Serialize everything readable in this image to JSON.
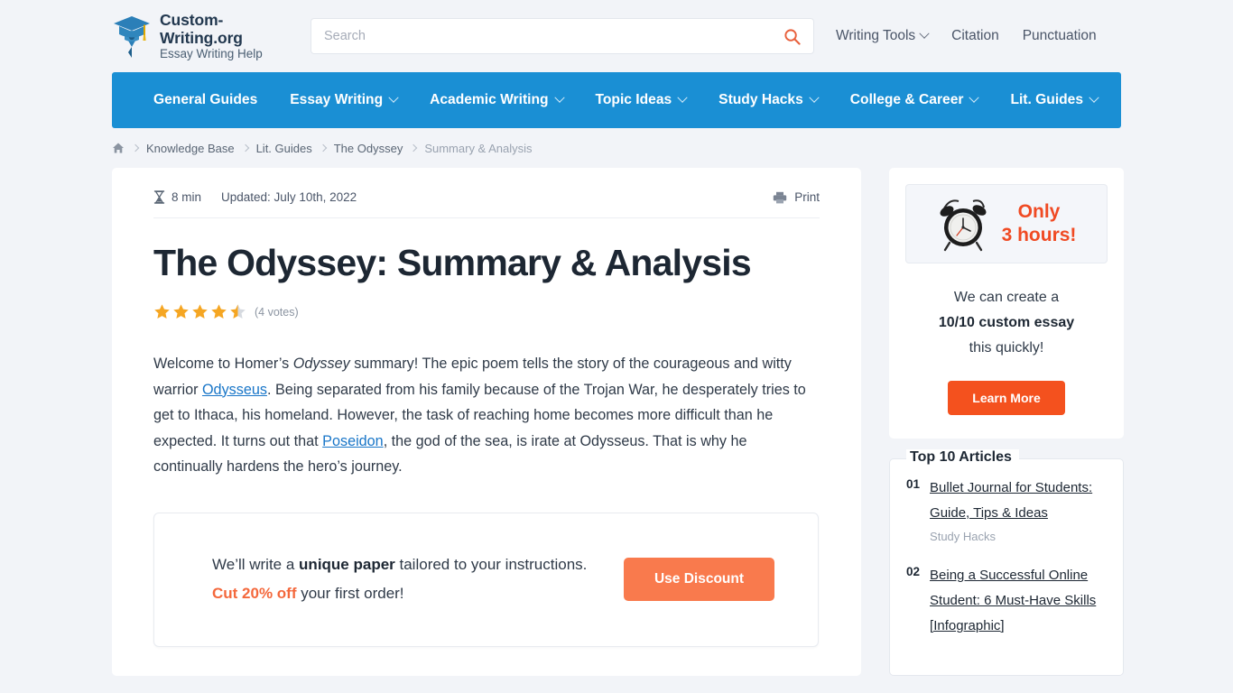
{
  "site": {
    "logo_title": "Custom-Writing.org",
    "logo_subtitle": "Essay Writing Help",
    "logo_icon": "graduation-cap-pen-icon"
  },
  "search": {
    "placeholder": "Search",
    "value": "",
    "icon": "search-icon",
    "icon_color": "#e8603c"
  },
  "top_nav": [
    {
      "label": "Writing Tools",
      "has_dropdown": true
    },
    {
      "label": "Citation",
      "has_dropdown": false
    },
    {
      "label": "Punctuation",
      "has_dropdown": false
    }
  ],
  "main_nav": {
    "background": "#1a8fd4",
    "items": [
      {
        "label": "General Guides",
        "has_dropdown": false
      },
      {
        "label": "Essay Writing",
        "has_dropdown": true
      },
      {
        "label": "Academic Writing",
        "has_dropdown": true
      },
      {
        "label": "Topic Ideas",
        "has_dropdown": true
      },
      {
        "label": "Study Hacks",
        "has_dropdown": true
      },
      {
        "label": "College & Career",
        "has_dropdown": true
      },
      {
        "label": "Lit. Guides",
        "has_dropdown": true
      }
    ]
  },
  "breadcrumb": {
    "home_icon": "home-icon",
    "items": [
      {
        "label": "Knowledge Base",
        "current": false
      },
      {
        "label": "Lit. Guides",
        "current": false
      },
      {
        "label": "The Odyssey",
        "current": false
      },
      {
        "label": "Summary & Analysis",
        "current": true
      }
    ]
  },
  "article": {
    "read_time": "8 min",
    "read_time_icon": "hourglass-icon",
    "updated": "Updated: July 10th, 2022",
    "print_label": "Print",
    "print_icon": "printer-icon",
    "title": "The Odyssey: Summary & Analysis",
    "rating": {
      "stars_filled": 4,
      "stars_half": 1,
      "stars_total": 5,
      "votes_label": "(4 votes)",
      "star_color": "#f5a623"
    },
    "intro": {
      "p1": "Welcome to Homer’s ",
      "em1": "Odyssey",
      "p2": " summary! The epic poem tells the story of the courageous and witty warrior ",
      "link1": "Odysseus",
      "p3": ". Being separated from his family because of the Trojan War, he desperately tries to get to Ithaca, his homeland. However, the task of reaching home becomes more difficult than he expected. It turns out that ",
      "link2": "Poseidon",
      "p4": ", the god of the sea, is irate at Odysseus. That is why he continually hardens the hero’s journey."
    },
    "promo": {
      "line1_a": "We’ll write a ",
      "line1_b": "unique paper",
      "line1_c": " tailored to your instructions.",
      "line2_a": "Cut 20% off",
      "line2_b": " your first order!",
      "button": "Use Discount",
      "button_color": "#f97a4d"
    }
  },
  "sidebar": {
    "clock": {
      "icon": "alarm-clock-icon",
      "line1": "Only",
      "line2": "3 hours!",
      "color": "#f04a23"
    },
    "pitch": {
      "line1": "We can create a",
      "line2": "10/10 custom essay",
      "line3": "this quickly!",
      "button": "Learn More",
      "button_color": "#f4511e"
    },
    "top_articles": {
      "title": "Top 10 Articles",
      "items": [
        {
          "number": "01",
          "title": "Bullet Journal for Students: Guide, Tips & Ideas",
          "category": "Study Hacks"
        },
        {
          "number": "02",
          "title": "Being a Successful Online Student: 6 Must-Have Skills [Infographic]",
          "category": ""
        }
      ]
    }
  }
}
